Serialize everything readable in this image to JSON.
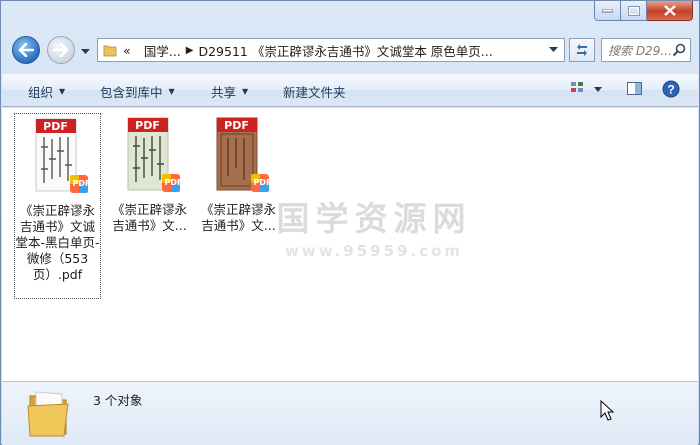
{
  "window": {
    "caption": {
      "minimize": "–",
      "maximize": "□",
      "close": "✕"
    }
  },
  "nav": {
    "back_icon": "arrow-left",
    "forward_icon": "arrow-right",
    "breadcrumb": {
      "overflow": "«",
      "items": [
        "国学...",
        "D29511 《崇正辟谬永吉通书》文诚堂本 原色单页..."
      ]
    },
    "search_placeholder": "搜索 D29..."
  },
  "toolbar": {
    "organize": "组织",
    "include_in_library": "包含到库中",
    "share": "共享",
    "new_folder": "新建文件夹"
  },
  "watermark": {
    "title": "国学资源网",
    "subtitle": "www.95959.com"
  },
  "files": [
    {
      "label": "《崇正辟谬永吉通书》文诚堂本-黑白单页-微修（553页）.pdf",
      "badge": "PDF",
      "cover": "white",
      "selected": true
    },
    {
      "label": "《崇正辟谬永吉通书》文...",
      "badge": "PDF",
      "cover": "green"
    },
    {
      "label": "《崇正辟谬永吉通书》文...",
      "badge": "PDF",
      "cover": "brown"
    }
  ],
  "status": {
    "count": "3 个对象"
  },
  "colors": {
    "pdf_red": "#cc2222",
    "toolbar_text": "#1e395b"
  }
}
